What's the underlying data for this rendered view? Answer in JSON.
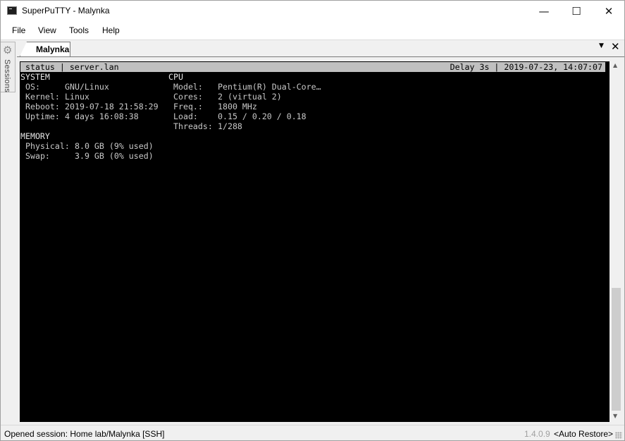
{
  "window": {
    "title": "SuperPuTTY - Malynka"
  },
  "titlebar_icons": {
    "app": "terminal-app-icon",
    "minimize": "minimize-icon",
    "maximize": "maximize-icon",
    "close": "close-icon"
  },
  "menu": {
    "items": [
      "File",
      "View",
      "Tools",
      "Help"
    ]
  },
  "sidebar": {
    "label": "Sessions",
    "icon": "gear-icon"
  },
  "tabs": [
    {
      "label": "Malynka",
      "active": true
    }
  ],
  "terminal": {
    "statusline": {
      "left": "status | server.lan",
      "right": "Delay 3s | 2019-07-23, 14:07:07"
    },
    "system": {
      "header": "SYSTEM",
      "rows": [
        {
          "key": "OS:",
          "value": "GNU/Linux"
        },
        {
          "key": "Kernel:",
          "value": "Linux"
        },
        {
          "key": "Reboot:",
          "value": "2019-07-18 21:58:29"
        },
        {
          "key": "Uptime:",
          "value": "4 days 16:08:38"
        }
      ]
    },
    "cpu": {
      "header": "CPU",
      "rows": [
        {
          "key": "Model:",
          "value": "Pentium(R) Dual-Core…"
        },
        {
          "key": "Cores:",
          "value": "2 (virtual 2)"
        },
        {
          "key": "Freq.:",
          "value": "1800 MHz"
        },
        {
          "key": "Load:",
          "value": "0.15 / 0.20 / 0.18"
        },
        {
          "key": "Threads:",
          "value": "1/288"
        }
      ]
    },
    "memory": {
      "header": "MEMORY",
      "rows": [
        {
          "key": "Physical:",
          "value": "8.0 GB (9% used)"
        },
        {
          "key": "Swap:",
          "value": "3.9 GB (0% used)"
        }
      ]
    }
  },
  "statusbar": {
    "message": "Opened session: Home lab/Malynka [SSH]",
    "version": "1.4.0.9",
    "restore": "<Auto Restore>"
  },
  "colors": {
    "terminal_bg": "#000000",
    "terminal_fg": "#c8c8c8",
    "statusline_bg": "#c0c0c0",
    "chrome_bg": "#f0f0f0"
  }
}
